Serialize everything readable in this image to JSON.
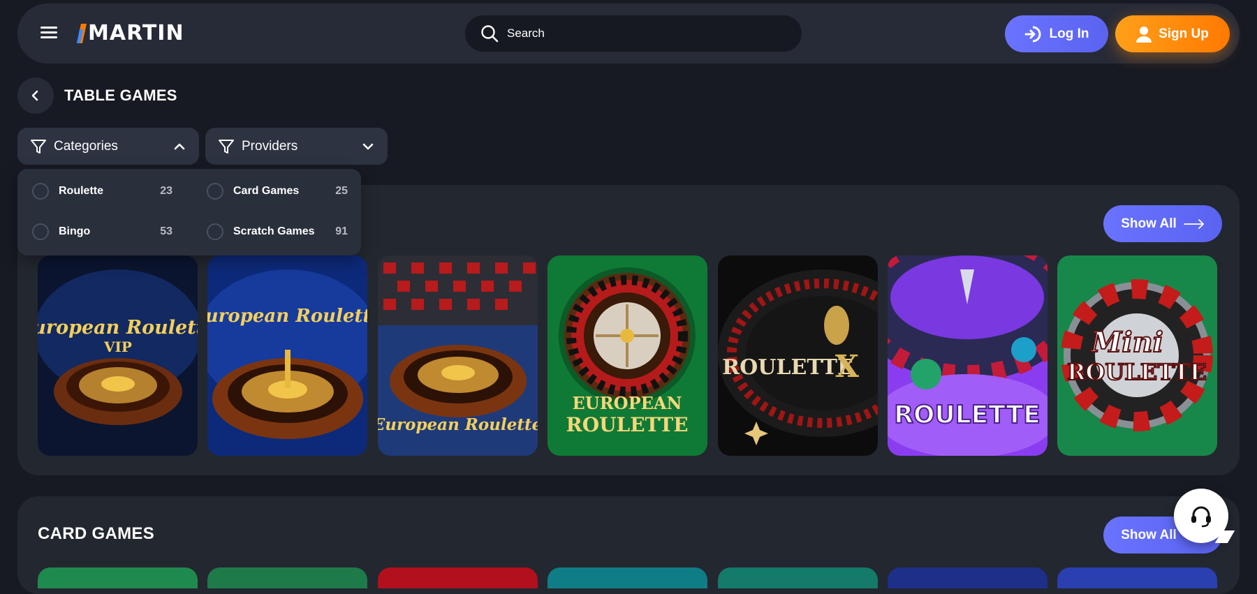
{
  "header": {
    "logo_text": "MARTIN",
    "search_placeholder": "Search",
    "login_label": "Log In",
    "signup_label": "Sign Up"
  },
  "page": {
    "title": "TABLE GAMES"
  },
  "filters": {
    "categories_label": "Categories",
    "providers_label": "Providers",
    "category_options": [
      {
        "label": "Roulette",
        "count": "23"
      },
      {
        "label": "Card Games",
        "count": "25"
      },
      {
        "label": "Bingo",
        "count": "53"
      },
      {
        "label": "Scratch Games",
        "count": "91"
      }
    ]
  },
  "sections": [
    {
      "title": "",
      "show_all": "Show All"
    },
    {
      "title": "CARD GAMES",
      "show_all": "Show All"
    }
  ],
  "games": [
    {
      "title": "European Roulette",
      "subtitle": "VIP",
      "bg": "#0b1530"
    },
    {
      "title": "European Roulette",
      "subtitle": "",
      "bg": "#0d2a7a"
    },
    {
      "title": "European Roulette",
      "subtitle": "",
      "bg": "#1f3a78"
    },
    {
      "title": "EUROPEAN",
      "subtitle": "ROULETTE",
      "bg": "#0f7a35"
    },
    {
      "title": "ROULETTE",
      "subtitle": "X",
      "bg": "#0c0c0c"
    },
    {
      "title": "ROULETTE",
      "subtitle": "",
      "bg": "#8a3df0"
    },
    {
      "title": "Mini",
      "subtitle": "ROULETTE",
      "bg": "#18884a"
    }
  ],
  "peek_colors": [
    "#1f8a4d",
    "#1f7a4a",
    "#b3101e",
    "#0f7d86",
    "#147a6a",
    "#1e2f8a",
    "#2a3fb0"
  ],
  "colors": {
    "accent": "#6a73ff",
    "signup": "#ff8a00",
    "background": "#171a23",
    "panel": "#272b37"
  },
  "icons": {
    "menu": "hamburger-icon",
    "search": "search-icon",
    "login": "login-icon",
    "signup": "user-icon",
    "back": "chevron-left-icon",
    "filter": "filter-icon",
    "support": "headset-icon"
  }
}
